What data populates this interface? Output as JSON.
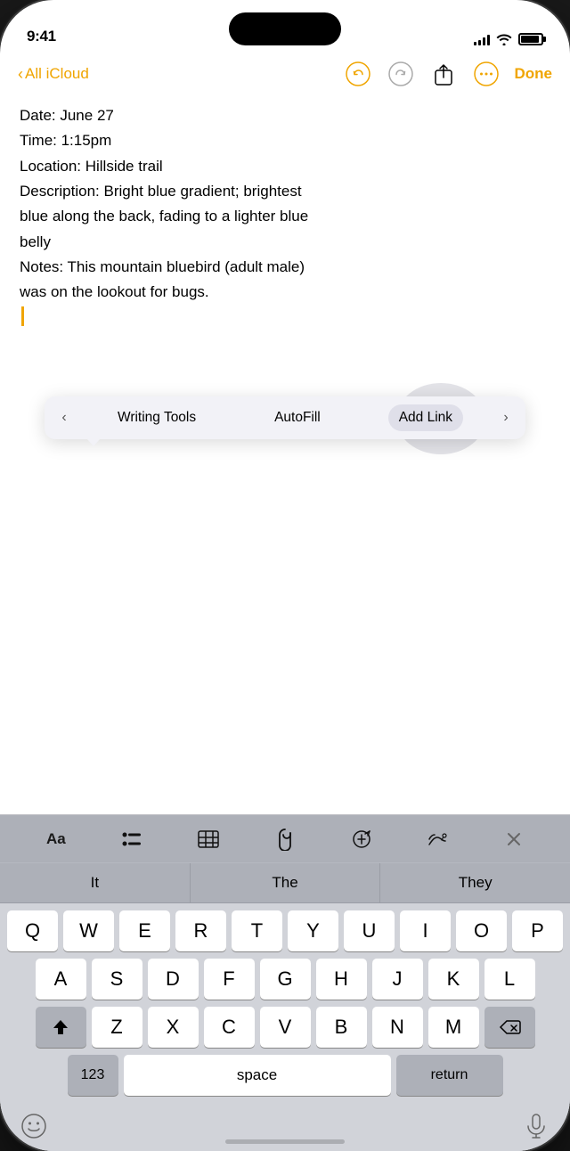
{
  "statusBar": {
    "time": "9:41",
    "signalBars": [
      4,
      6,
      8,
      11,
      14
    ],
    "wifi": "wifi",
    "battery": "battery"
  },
  "navBar": {
    "backLabel": "All iCloud",
    "doneLabel": "Done"
  },
  "noteContent": {
    "line1": "Date: June 27",
    "line2": "Time: 1:15pm",
    "line3": "Location: Hillside trail",
    "line4": "Description: Bright blue gradient; brightest",
    "line5": "blue along the back, fading to a lighter blue",
    "line6": "belly",
    "line7": "Notes: This mountain bluebird (adult male)",
    "line8": "was on the lookout for bugs."
  },
  "toolbar": {
    "leftArrow": "‹",
    "rightArrow": "›",
    "item1": "Writing Tools",
    "item2": "AutoFill",
    "item3": "Add Link"
  },
  "keyboardToolbar": {
    "formatIcon": "Aa",
    "listIcon": "list",
    "tableIcon": "table",
    "attachIcon": "attach",
    "penIcon": "pen",
    "drawIcon": "draw",
    "closeIcon": "close"
  },
  "predictive": {
    "word1": "It",
    "word2": "The",
    "word3": "They"
  },
  "keyRows": {
    "row1": [
      "Q",
      "W",
      "E",
      "R",
      "T",
      "Y",
      "U",
      "I",
      "O",
      "P"
    ],
    "row2": [
      "A",
      "S",
      "D",
      "F",
      "G",
      "H",
      "J",
      "K",
      "L"
    ],
    "row3": [
      "Z",
      "X",
      "C",
      "V",
      "B",
      "N",
      "M"
    ],
    "bottomLeft": "123",
    "space": "space",
    "bottomRight": "return"
  }
}
